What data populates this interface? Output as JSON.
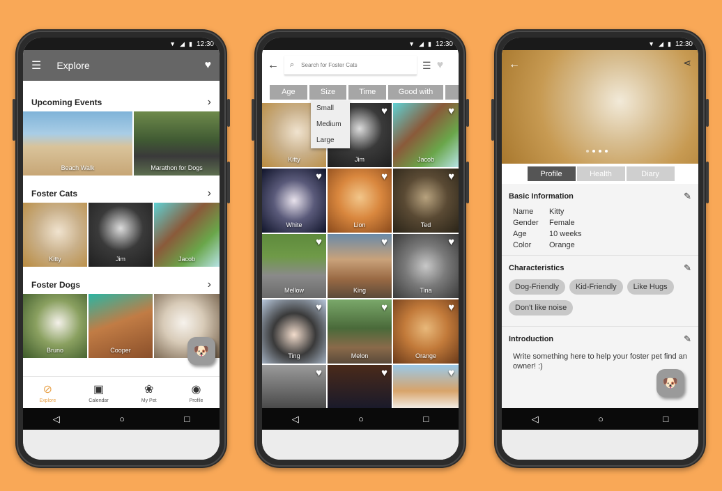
{
  "status": {
    "time": "12:30"
  },
  "explore": {
    "title": "Explore",
    "sections": [
      {
        "title": "Upcoming Events",
        "items": [
          "Beach Walk",
          "Marathon for Dogs"
        ]
      },
      {
        "title": "Foster Cats",
        "items": [
          "Kitty",
          "Jim",
          "Jacob"
        ]
      },
      {
        "title": "Foster Dogs",
        "items": [
          "Bruno",
          "Cooper",
          ""
        ]
      }
    ],
    "bottom_nav": [
      "Explore",
      "Calendar",
      "My Pet",
      "Profile"
    ]
  },
  "search": {
    "placeholder": "Search for Foster Cats",
    "filters": [
      "Age",
      "Size",
      "Time",
      "Good with"
    ],
    "size_options": [
      "Small",
      "Medium",
      "Large"
    ],
    "cats": [
      "Kitty",
      "Jim",
      "Jacob",
      "White",
      "Lion",
      "Ted",
      "Mellow",
      "King",
      "Tina",
      "Ting",
      "Melon",
      "Orange",
      "",
      "",
      ""
    ]
  },
  "profile": {
    "tabs": [
      "Profile",
      "Health",
      "Diary"
    ],
    "basic_title": "Basic Information",
    "basic": [
      {
        "k": "Name",
        "v": "Kitty"
      },
      {
        "k": "Gender",
        "v": "Female"
      },
      {
        "k": "Age",
        "v": "10 weeks"
      },
      {
        "k": "Color",
        "v": "Orange"
      }
    ],
    "char_title": "Characteristics",
    "tags": [
      "Dog-Friendly",
      "Kid-Friendly",
      "Like Hugs",
      "Don't like noise"
    ],
    "intro_title": "Introduction",
    "intro_text": "Write something here to help your foster pet find an owner! :)"
  }
}
